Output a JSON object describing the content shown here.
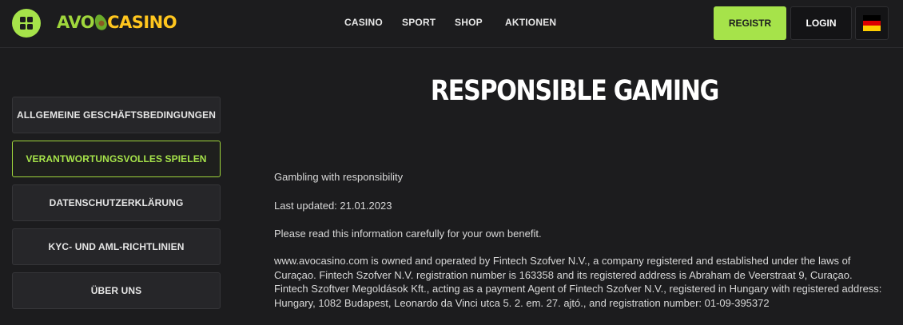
{
  "header": {
    "logo_part1": "AVO",
    "logo_part2": "CASINO",
    "nav": [
      "CASINO",
      "SPORT",
      "SHOP",
      "AKTIONEN"
    ],
    "register_label": "REGISTR",
    "login_label": "LOGIN",
    "language_flag_colors": [
      "#000000",
      "#dd0000",
      "#ffce00"
    ]
  },
  "sidebar": {
    "items": [
      {
        "label": "ALLGEMEINE GESCHÄFTSBEDINGUNGEN",
        "active": false
      },
      {
        "label": "VERANTWORTUNGSVOLLES SPIELEN",
        "active": true
      },
      {
        "label": "DATENSCHUTZERKLÄRUNG",
        "active": false
      },
      {
        "label": "KYC- UND AML-RICHTLINIEN",
        "active": false
      },
      {
        "label": "ÜBER UNS",
        "active": false
      }
    ]
  },
  "main": {
    "title": "RESPONSIBLE GAMING",
    "paragraphs": [
      "Gambling with responsibility",
      "Last updated: 21.01.2023",
      "Please read this information carefully for your own benefit.",
      "www.avocasino.com is owned and operated by Fintech Szofver N.V., a company registered and established under the laws of Curaçao. Fintech Szofver N.V. registration number is 163358 and its registered address is Abraham de Veerstraat 9, Curaçao. Fintech Szoftver Megoldások Kft., acting as a payment Agent of Fintech Szofver N.V., registered in Hungary with registered address: Hungary, 1082 Budapest, Leonardo da Vinci utca 5. 2. em. 27. ajtó., and registration number: 01-09-395372"
    ]
  },
  "colors": {
    "accent": "#a6e34a",
    "background": "#1c1c1e",
    "logo_yellow": "#ffc61e"
  }
}
